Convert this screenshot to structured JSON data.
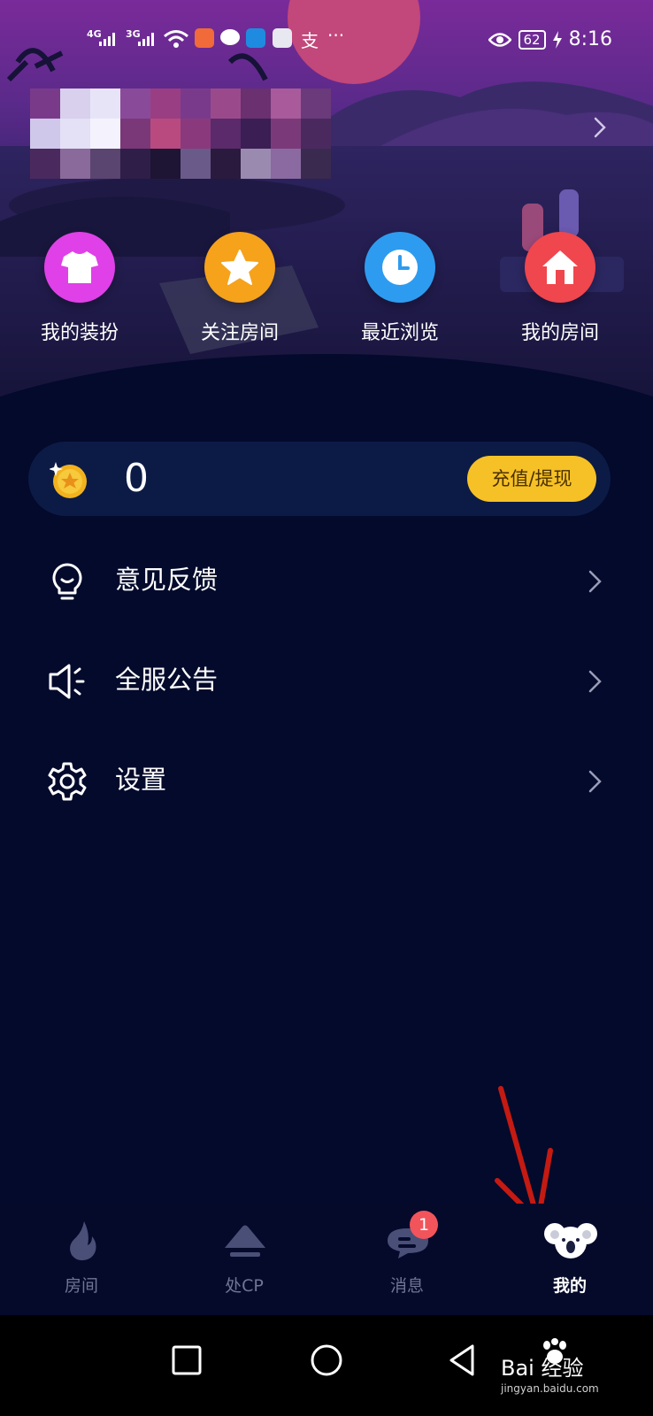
{
  "status_bar": {
    "network_1": "4G",
    "network_2": "3G",
    "battery": "62",
    "time": "8:16"
  },
  "quick_actions": [
    {
      "label": "我的装扮",
      "icon": "shirt-icon",
      "color": "#e040e8"
    },
    {
      "label": "关注房间",
      "icon": "star-icon",
      "color": "#f6a21a"
    },
    {
      "label": "最近浏览",
      "icon": "clock-icon",
      "color": "#2d9cf0"
    },
    {
      "label": "我的房间",
      "icon": "house-icon",
      "color": "#f0464e"
    }
  ],
  "balance": {
    "coin_icon": "gold-coin-icon",
    "value": "0",
    "recharge_label": "充值/提现"
  },
  "menu": [
    {
      "label": "意见反馈",
      "icon": "lightbulb-icon"
    },
    {
      "label": "全服公告",
      "icon": "speaker-icon"
    },
    {
      "label": "设置",
      "icon": "gear-icon"
    }
  ],
  "tabs": [
    {
      "label": "房间",
      "icon": "flame-icon",
      "active": false
    },
    {
      "label": "处CP",
      "icon": "mountain-icon",
      "active": false
    },
    {
      "label": "消息",
      "icon": "chat-bubble-icon",
      "active": false,
      "badge": "1"
    },
    {
      "label": "我的",
      "icon": "koala-icon",
      "active": true
    }
  ],
  "watermark": {
    "text": "Bai 经验",
    "sub": "jingyan.baidu.com"
  },
  "colors": {
    "background": "#030a2b",
    "accent_yellow": "#f6c126",
    "badge_red": "#f2545b",
    "inactive_tab": "#707596"
  }
}
